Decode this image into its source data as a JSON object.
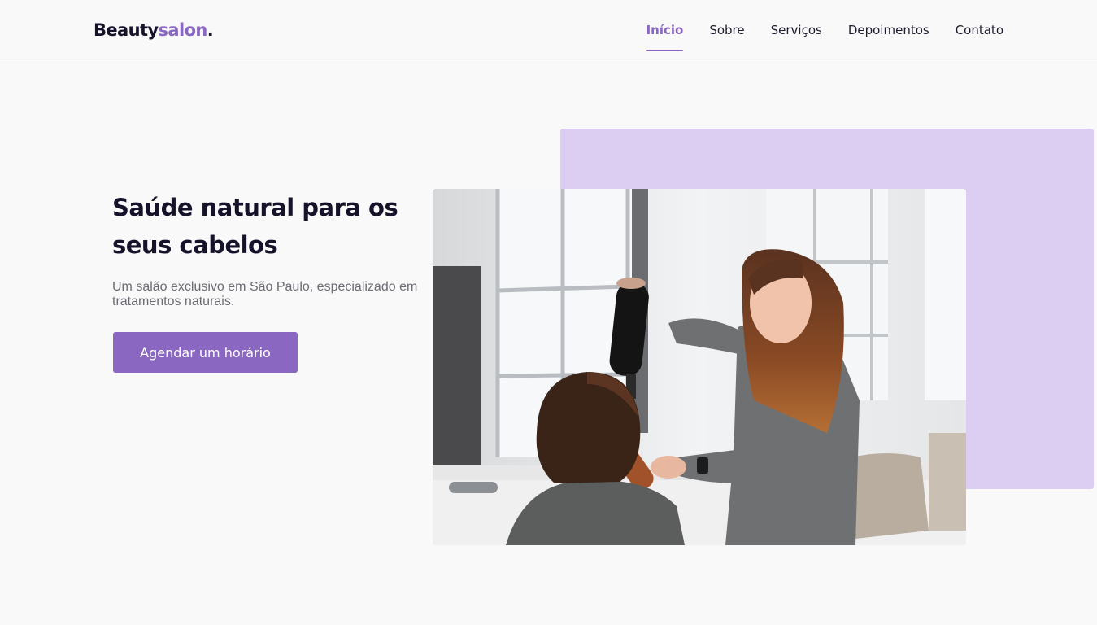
{
  "header": {
    "logo": {
      "part1": "Beauty",
      "part2": "salon",
      "dot": "."
    },
    "nav": [
      {
        "label": "Início",
        "active": true
      },
      {
        "label": "Sobre",
        "active": false
      },
      {
        "label": "Serviços",
        "active": false
      },
      {
        "label": "Depoimentos",
        "active": false
      },
      {
        "label": "Contato",
        "active": false
      }
    ]
  },
  "hero": {
    "title": "Saúde natural para os seus cabelos",
    "subtitle": "Um salão exclusivo em São Paulo, especializado em tratamentos naturais.",
    "cta_label": "Agendar um horário",
    "image_alt": "Cabeleireira secando o cabelo de uma cliente no salão"
  },
  "colors": {
    "accent": "#8a67c0",
    "accent_light": "#dccdf3",
    "text_dark": "#16122a",
    "text_muted": "#6b6b73",
    "background": "#f9f9f9"
  }
}
